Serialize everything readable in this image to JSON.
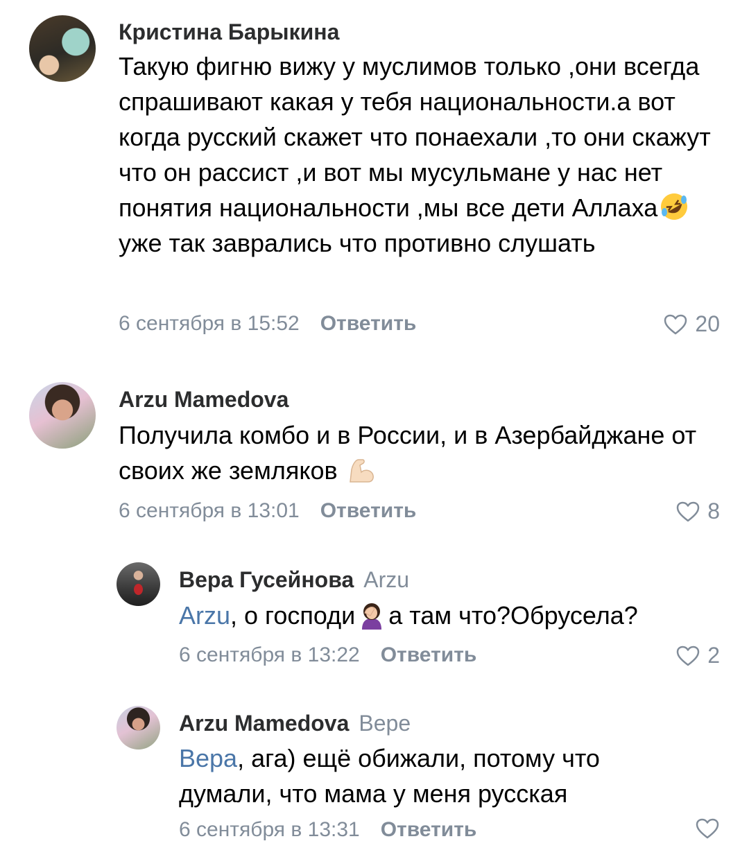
{
  "comments": [
    {
      "author": "Кристина Барыкина",
      "text_parts": [
        "Такую фигню вижу у муслимов только ,они всегда спрашивают какая у тебя национальности.а вот когда русский скажет что понаехали ,то они скажут что он рассист ,и вот мы мусульмане у нас нет понятия национальности ,мы все дети Аллаха",
        "уже так заврались что противно слушать"
      ],
      "emoji": "rolling-on-floor-laughing-emoji",
      "date": "6 сентября в 15:52",
      "reply_label": "Ответить",
      "likes": "20"
    },
    {
      "author": "Arzu Mamedova",
      "text_parts": [
        "Получила комбо и в России, и в Азербайджане от своих же земляков"
      ],
      "emoji": "flexed-biceps-emoji",
      "date": "6 сентября в 13:01",
      "reply_label": "Ответить",
      "likes": "8"
    },
    {
      "author": "Вера Гусейнова",
      "reply_to": "Arzu",
      "mention": "Arzu",
      "text_parts": [
        ", о господи",
        "а там что?Обрусела?"
      ],
      "emoji": "woman-facepalming-emoji",
      "date": "6 сентября в 13:22",
      "reply_label": "Ответить",
      "likes": "2"
    },
    {
      "author": "Arzu Mamedova",
      "reply_to": "Вере",
      "mention": "Вера",
      "text_parts": [
        ", ага) ещё обижали, потому что думали, что мама у меня русская"
      ],
      "date": "6 сентября в 13:31",
      "reply_label": "Ответить"
    }
  ],
  "colors": {
    "meta": "#818c99",
    "mention": "#4a76a8",
    "author": "#2c2d2e"
  }
}
